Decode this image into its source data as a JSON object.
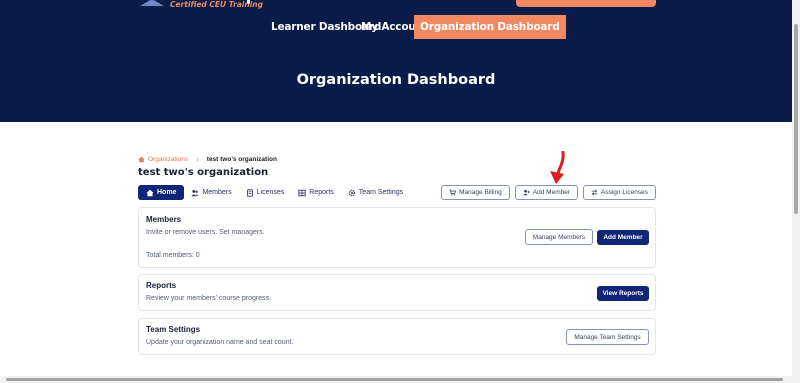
{
  "header": {
    "logo_text": "Certified CEU Training",
    "nav": [
      {
        "label": "Learner Dashboard"
      },
      {
        "label": "My Account"
      },
      {
        "label": "Organization Dashboard"
      }
    ]
  },
  "hero": {
    "title": "Organization Dashboard"
  },
  "breadcrumb": {
    "root": "Organizations",
    "separator": "›",
    "current": "test two's organization"
  },
  "org": {
    "title": "test two's organization"
  },
  "tabs": [
    {
      "label": "Home",
      "icon": "home-icon"
    },
    {
      "label": "Members",
      "icon": "users-icon"
    },
    {
      "label": "Licenses",
      "icon": "license-icon"
    },
    {
      "label": "Reports",
      "icon": "reports-icon"
    },
    {
      "label": "Team Settings",
      "icon": "gear-icon"
    }
  ],
  "actions": {
    "billing": "Manage Billing",
    "add_member": "Add Member",
    "assign": "Assign Licenses"
  },
  "members_card": {
    "title": "Members",
    "desc": "Invite or remove users. Set managers.",
    "total": "Total members: 0",
    "manage_label": "Manage Members",
    "add_label": "Add Member"
  },
  "reports_card": {
    "title": "Reports",
    "desc": "Review your members' course progress.",
    "button": "View Reports"
  },
  "settings_card": {
    "title": "Team Settings",
    "desc": "Update your organization name and seat count.",
    "button": "Manage Team Settings"
  },
  "colors": {
    "navy": "#0b1b4a",
    "primary": "#0f2575",
    "accent": "#f08862",
    "annotation": "#e01b1b"
  }
}
